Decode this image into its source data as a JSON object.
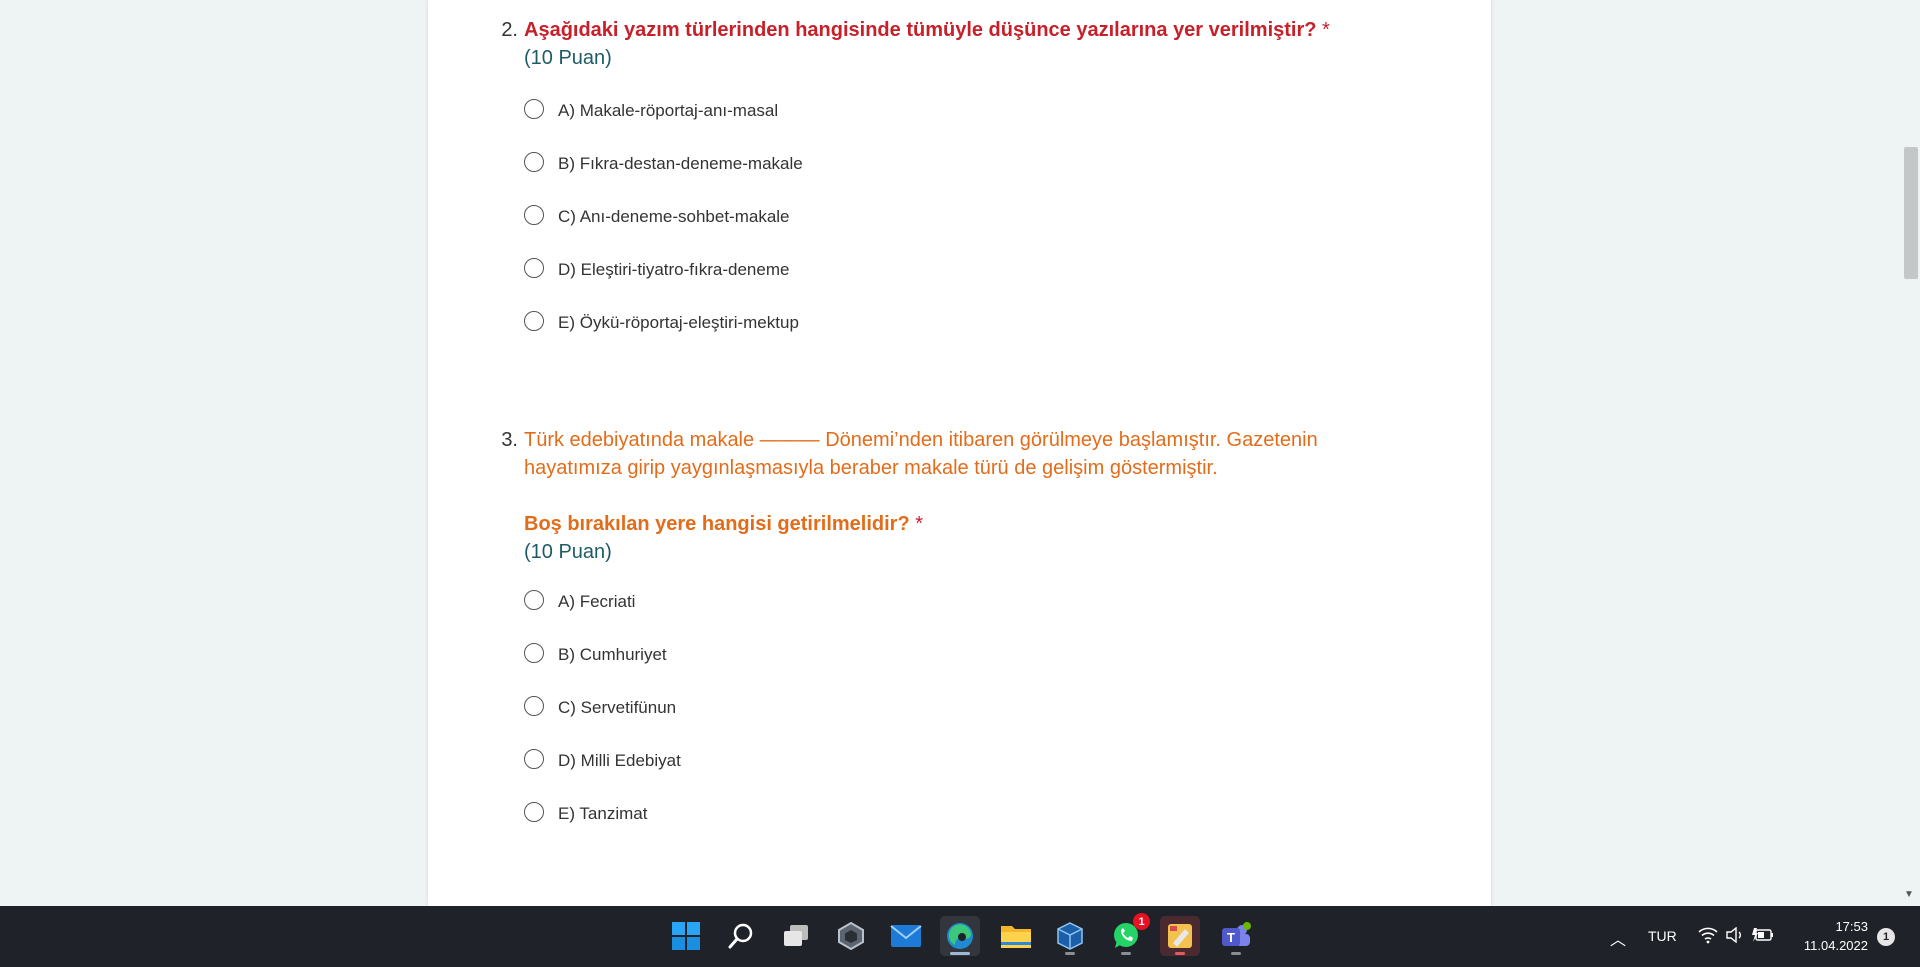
{
  "questions": [
    {
      "number": "2.",
      "title": "Aşağıdaki yazım türlerinden hangisinde tümüyle düşünce yazılarına yer verilmiştir?",
      "required_mark": "*",
      "points": "(10 Puan)",
      "options": [
        "A) Makale-röportaj-anı-masal",
        "B) Fıkra-destan-deneme-makale",
        "C) Anı-deneme-sohbet-makale",
        "D) Eleştiri-tiyatro-fıkra-deneme",
        "E) Öykü-röportaj-eleştiri-mektup"
      ]
    },
    {
      "number": "3.",
      "intro": "Türk edebiyatında makale ——— Dönemi’nden itibaren görülmeye başlamıştır. Gazetenin hayatımıza girip yaygınlaşmasıyla beraber makale türü de gelişim göstermiştir.",
      "title": "Boş bırakılan yere hangisi getirilmelidir?",
      "required_mark": "*",
      "points": "(10 Puan)",
      "options": [
        "A) Fecriati",
        "B) Cumhuriyet",
        "C) Servetifünun",
        "D) Milli Edebiyat",
        "E) Tanzimat"
      ]
    }
  ],
  "taskbar": {
    "icons": [
      "windows-start-icon",
      "search-icon",
      "task-view-icon",
      "widget-app-icon",
      "mail-icon",
      "edge-browser-icon",
      "file-explorer-icon",
      "virtualbox-icon",
      "whatsapp-icon",
      "paint-app-icon",
      "teams-icon"
    ],
    "whatsapp_badge": "1",
    "language": "TUR",
    "time": "17:53",
    "date": "11.04.2022",
    "notification_count": "1"
  },
  "colors": {
    "question_title_red": "#c8202a",
    "question_intro_orange": "#e36c1a",
    "points_teal": "#1e5b66",
    "taskbar_bg": "#1f2228",
    "page_bg": "#eef3f4"
  }
}
